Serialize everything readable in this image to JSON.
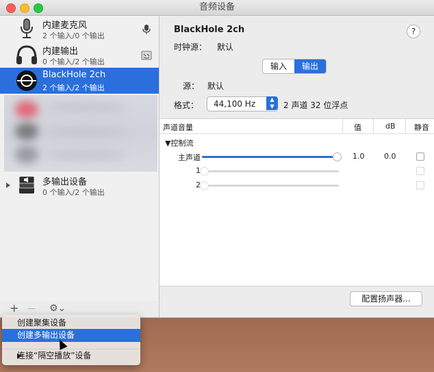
{
  "window": {
    "title": "音频设备"
  },
  "sidebar": {
    "devices": [
      {
        "name": "内建麦克风",
        "sub": "2 个输入/0 个输出",
        "icon": "microphone-icon",
        "trail": "mic-small-icon"
      },
      {
        "name": "内建输出",
        "sub": "0 个输入/2 个输出",
        "icon": "headphones-icon",
        "trail": "finder-icon"
      },
      {
        "name": "BlackHole 2ch",
        "sub": "2 个输入/2 个输出",
        "icon": "blackhole-icon",
        "selected": true
      },
      {
        "name": "多输出设备",
        "sub": "0 个输入/2 个输出",
        "icon": "multi-output-icon"
      }
    ],
    "footer": {
      "add": "+",
      "remove": "—",
      "gear": "⚙︎⌄"
    }
  },
  "detail": {
    "device_title": "BlackHole 2ch",
    "help": "?",
    "clock_label": "时钟源：",
    "clock_value": "默认",
    "tabs": [
      {
        "label": "输入"
      },
      {
        "label": "输出",
        "active": true
      }
    ],
    "source_label": "源：",
    "source_value": "默认",
    "format_label": "格式：",
    "format_value": "44,100 Hz",
    "format_desc": "2 声道 32 位浮点",
    "table": {
      "headers": {
        "channel": "声道音量",
        "value": "值",
        "db": "dB",
        "mute": "静音"
      },
      "group": "▼控制流",
      "rows": [
        {
          "label": "主声道",
          "value": "1.0",
          "db": "0.0",
          "level": 1.0
        },
        {
          "label": "1",
          "value": "",
          "db": "",
          "level": 0.0
        },
        {
          "label": "2",
          "value": "",
          "db": "",
          "level": 0.0
        }
      ]
    },
    "configure_button": "配置扬声器..."
  },
  "menu": {
    "items": [
      {
        "label": "创建聚集设备"
      },
      {
        "label": "创建多输出设备",
        "highlighted": true
      },
      {
        "label": "连接“隔空播放”设备",
        "submenu": "▶"
      }
    ]
  },
  "colors": {
    "accent": "#2a6fdb"
  }
}
